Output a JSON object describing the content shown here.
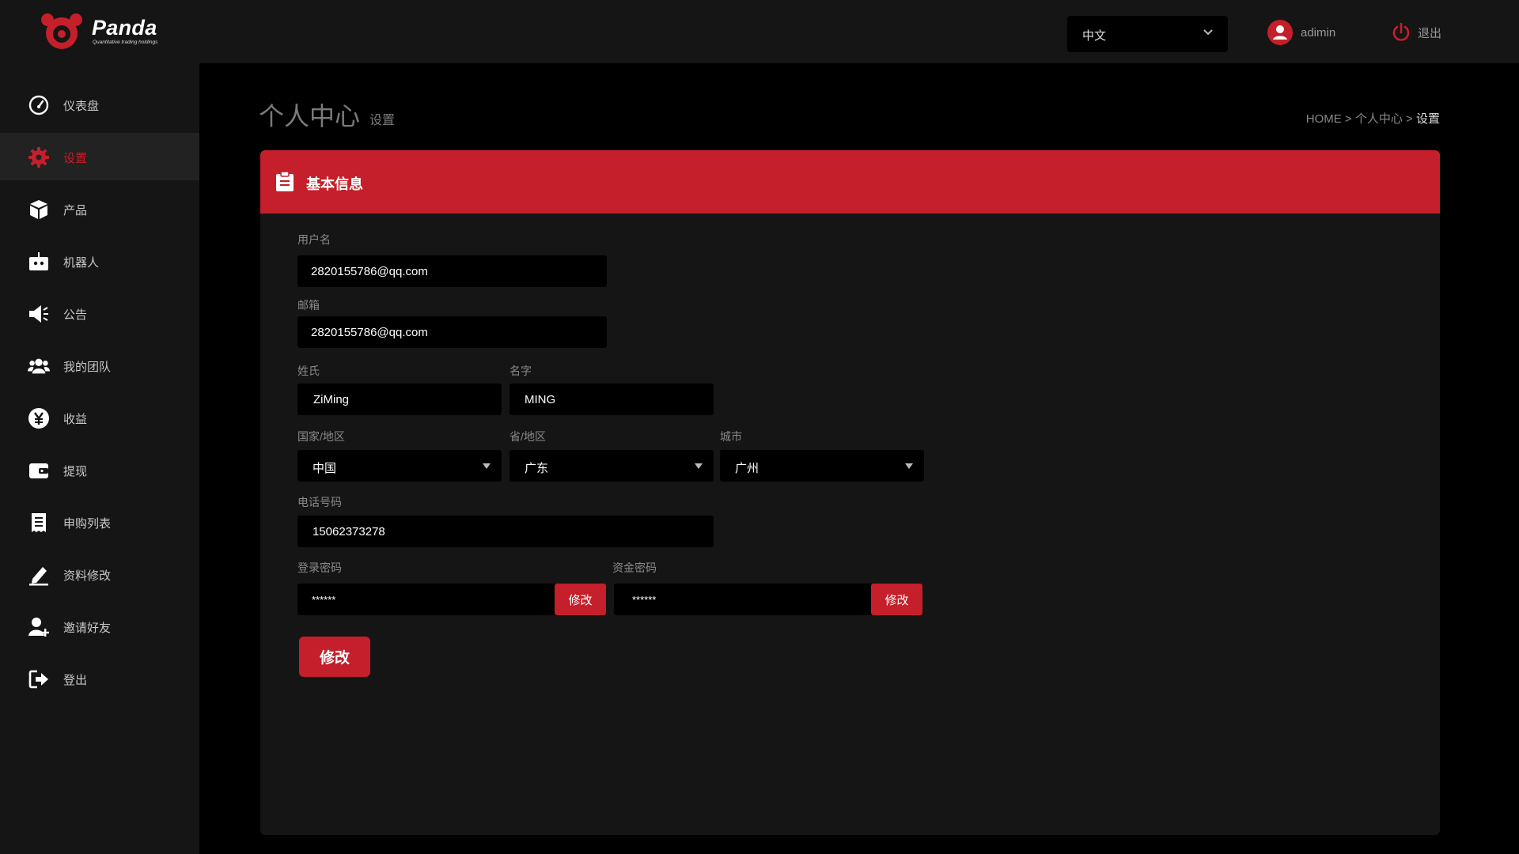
{
  "brand": {
    "name": "Panda",
    "tagline": "Quantitative trading holdings",
    "accent": "#c41f2a"
  },
  "header": {
    "language": "中文",
    "username": "adimin",
    "logout_label": "退出"
  },
  "sidebar": {
    "items": [
      {
        "label": "仪表盘",
        "icon": "speedometer-icon"
      },
      {
        "label": "设置",
        "icon": "gear-icon",
        "active": true
      },
      {
        "label": "产品",
        "icon": "box-icon"
      },
      {
        "label": "机器人",
        "icon": "robot-icon"
      },
      {
        "label": "公告",
        "icon": "megaphone-icon"
      },
      {
        "label": "我的团队",
        "icon": "team-icon"
      },
      {
        "label": "收益",
        "icon": "yen-icon"
      },
      {
        "label": "提现",
        "icon": "wallet-icon"
      },
      {
        "label": "申购列表",
        "icon": "receipt-icon"
      },
      {
        "label": "资料修改",
        "icon": "edit-icon"
      },
      {
        "label": "邀请好友",
        "icon": "add-user-icon"
      },
      {
        "label": "登出",
        "icon": "sign-out-icon"
      }
    ]
  },
  "page": {
    "title": "个人中心",
    "subtitle": "设置",
    "breadcrumb": {
      "home": "HOME",
      "sep": ">",
      "parent": "个人中心",
      "current": "设置"
    }
  },
  "form": {
    "section_title": "基本信息",
    "username": {
      "label": "用户名",
      "value": "2820155786@qq.com"
    },
    "email": {
      "label": "邮箱",
      "value": "2820155786@qq.com"
    },
    "surname": {
      "label": "姓氏",
      "value": "ZiMing"
    },
    "given_name": {
      "label": "名字",
      "value": "MING"
    },
    "country": {
      "label": "国家/地区",
      "value": "中国"
    },
    "province": {
      "label": "省/地区",
      "value": "广东"
    },
    "city": {
      "label": "城市",
      "value": "广州"
    },
    "phone": {
      "label": "电话号码",
      "value": "15062373278"
    },
    "login_password": {
      "label": "登录密码",
      "value": "******",
      "button": "修改"
    },
    "fund_password": {
      "label": "资金密码",
      "value": "******",
      "button": "修改"
    },
    "submit_label": "修改"
  }
}
